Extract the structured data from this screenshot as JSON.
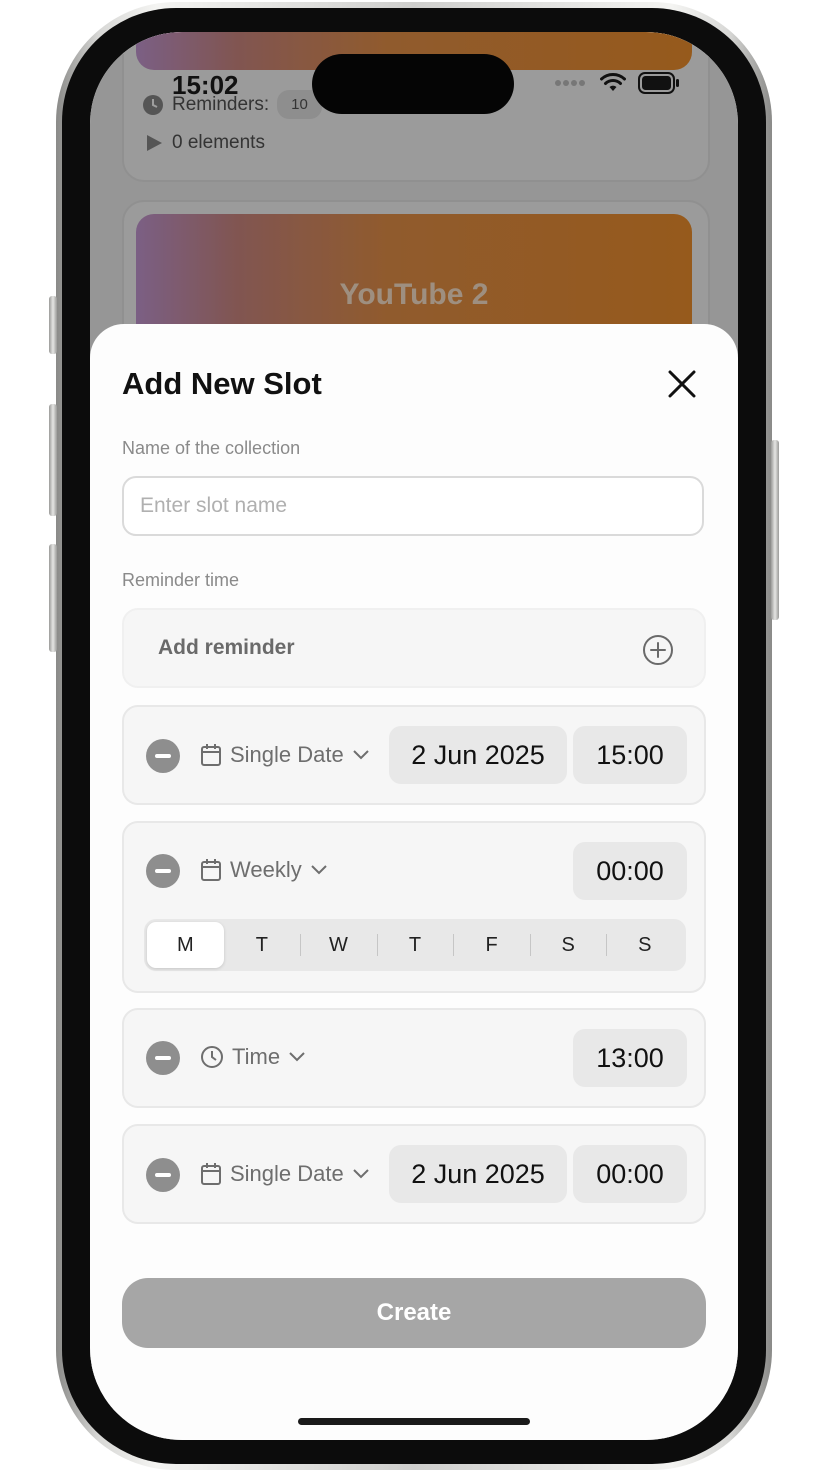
{
  "status_bar": {
    "time": "15:02"
  },
  "background": {
    "card1": {
      "reminders_label": "Reminders:",
      "reminders_badge": "10",
      "elements": "0 elements"
    },
    "card2": {
      "title": "YouTube 2"
    }
  },
  "sheet": {
    "title": "Add New Slot",
    "name_label": "Name of the collection",
    "name_value": "",
    "name_placeholder": "Enter slot name",
    "reminder_label": "Reminder time",
    "add_reminder_label": "Add reminder",
    "reminders": [
      {
        "type": "Single Date",
        "date": "2 Jun 2025",
        "time": "15:00"
      },
      {
        "type": "Weekly",
        "time": "00:00",
        "days": [
          "M",
          "T",
          "W",
          "T",
          "F",
          "S",
          "S"
        ],
        "selected_day": "M"
      },
      {
        "type": "Time",
        "time": "13:00"
      },
      {
        "type": "Single Date",
        "date": "2 Jun 2025",
        "time": "00:00"
      }
    ],
    "create_label": "Create"
  },
  "colors": {
    "accent_gradient_start": "#c79ad6",
    "accent_gradient_end": "#f2922e",
    "button_disabled": "#a6a6a6"
  }
}
